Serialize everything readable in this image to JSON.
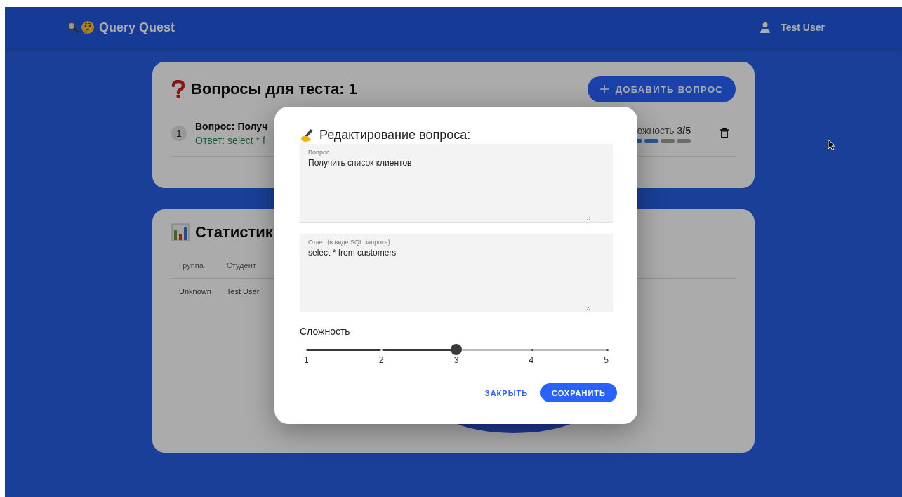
{
  "header": {
    "logo": "Query Quest",
    "user": "Test User"
  },
  "questions_card": {
    "title": "Вопросы для теста: 1",
    "add_button": "ДОБАВИТЬ ВОПРОС",
    "items": [
      {
        "number": "1",
        "question": "Вопрос: Получ",
        "answer": "Ответ: select * f",
        "difficulty_label": "ожность",
        "difficulty_value": "3/5",
        "segments": [
          {
            "filled": true
          },
          {
            "filled": true
          },
          {
            "filled": false
          },
          {
            "filled": false
          }
        ]
      }
    ]
  },
  "stats_card": {
    "title": "Статистик",
    "table": {
      "columns": [
        "Группа",
        "Студент"
      ],
      "rows": [
        [
          "Unknown",
          "Test User"
        ]
      ]
    }
  },
  "dialog": {
    "title": "Редактирование вопроса:",
    "fields": [
      {
        "label": "Вопрос",
        "value": "Получить список клиентов"
      },
      {
        "label": "Ответ (в виде SQL запроса)",
        "value": "select * from customers"
      }
    ],
    "difficulty": {
      "label": "Сложность",
      "level": 0.5,
      "ticks": [
        "1",
        "2",
        "3",
        "4",
        "5"
      ]
    },
    "buttons": [
      {
        "label": "ЗАКРЫТЬ",
        "kind": "text"
      },
      {
        "label": "СОХРАНИТЬ",
        "kind": "filled"
      }
    ]
  }
}
